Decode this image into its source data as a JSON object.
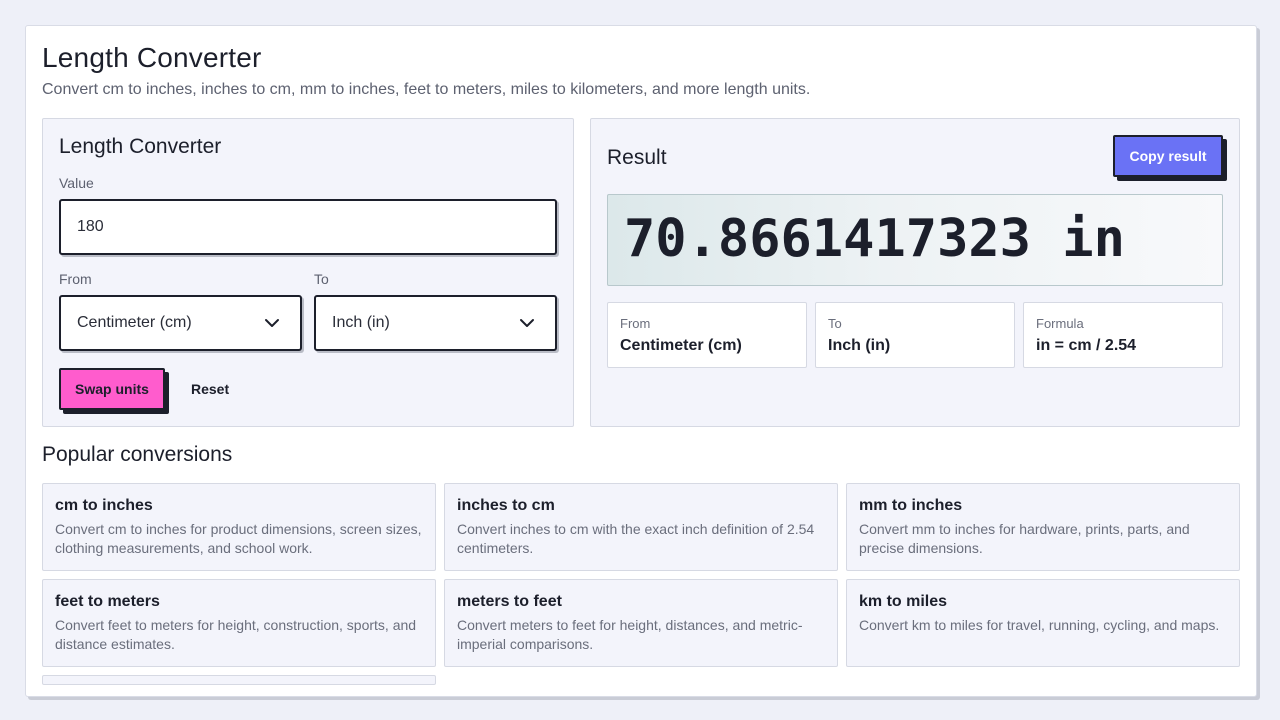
{
  "header": {
    "title": "Length Converter",
    "subtitle": "Convert cm to inches, inches to cm, mm to inches, feet to meters, miles to kilometers, and more length units."
  },
  "converter": {
    "title": "Length Converter",
    "value_label": "Value",
    "value": "180",
    "from_label": "From",
    "from_value": "Centimeter (cm)",
    "to_label": "To",
    "to_value": "Inch (in)",
    "swap_label": "Swap units",
    "reset_label": "Reset"
  },
  "result": {
    "title": "Result",
    "copy_label": "Copy result",
    "value": "70.8661417323 in",
    "info": [
      {
        "label": "From",
        "value": "Centimeter (cm)"
      },
      {
        "label": "To",
        "value": "Inch (in)"
      },
      {
        "label": "Formula",
        "value": "in = cm / 2.54"
      }
    ]
  },
  "popular": {
    "title": "Popular conversions",
    "items": [
      {
        "title": "cm to inches",
        "desc": "Convert cm to inches for product dimensions, screen sizes, clothing measurements, and school work."
      },
      {
        "title": "inches to cm",
        "desc": "Convert inches to cm with the exact inch definition of 2.54 centimeters."
      },
      {
        "title": "mm to inches",
        "desc": "Convert mm to inches for hardware, prints, parts, and precise dimensions."
      },
      {
        "title": "feet to meters",
        "desc": "Convert feet to meters for height, construction, sports, and distance estimates."
      },
      {
        "title": "meters to feet",
        "desc": "Convert meters to feet for height, distances, and metric-imperial comparisons."
      },
      {
        "title": "km to miles",
        "desc": "Convert km to miles for travel, running, cycling, and maps."
      }
    ]
  },
  "colors": {
    "swap_button": "#ff5ccd",
    "copy_button": "#6a72f5",
    "text": "#1c1f2b"
  },
  "icons": {
    "select_chevron": "chevron-down-icon"
  }
}
